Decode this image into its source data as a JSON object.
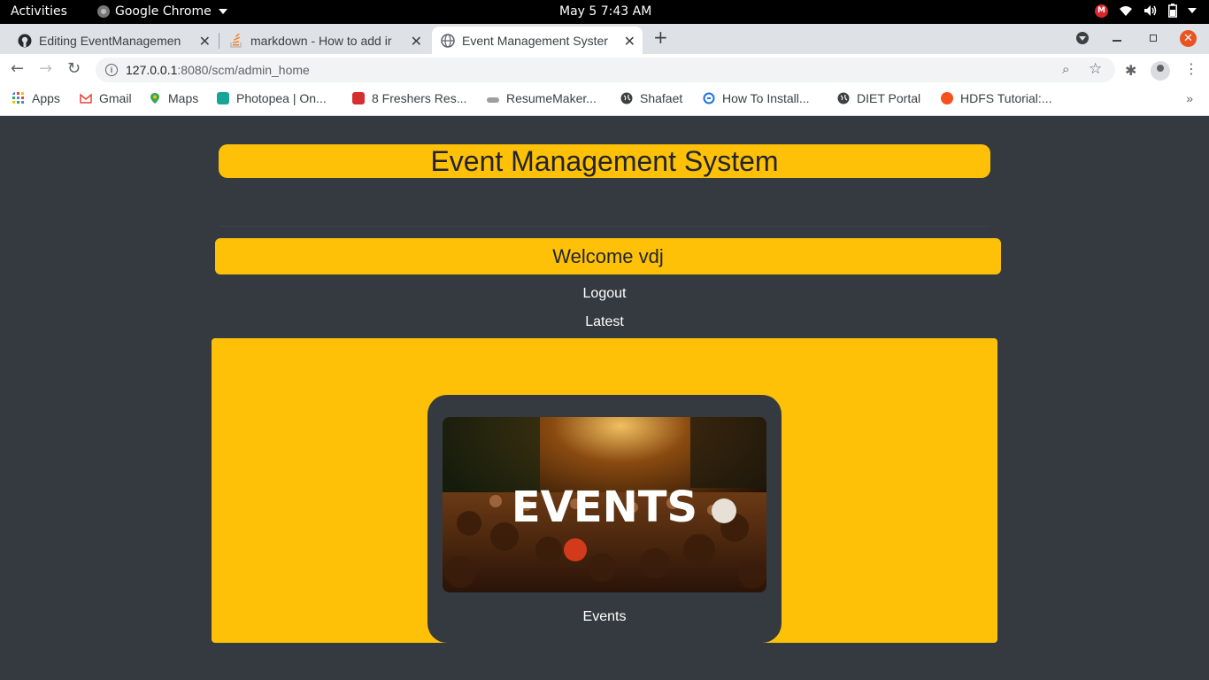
{
  "os": {
    "activities": "Activities",
    "app_name": "Google Chrome",
    "clock": "May 5   7:43 AM"
  },
  "browser": {
    "tabs": [
      {
        "label": "Editing EventManagemen"
      },
      {
        "label": "markdown - How to add ir"
      },
      {
        "label": "Event Management Syster"
      }
    ],
    "url_host": "127.0.0.1",
    "url_rest": ":8080/scm/admin_home",
    "bookmarks": [
      {
        "label": "Apps"
      },
      {
        "label": "Gmail"
      },
      {
        "label": "Maps"
      },
      {
        "label": "Photopea | On..."
      },
      {
        "label": "8 Freshers Res..."
      },
      {
        "label": "ResumeMaker..."
      },
      {
        "label": "Shafaet"
      },
      {
        "label": "How To Install..."
      },
      {
        "label": "DIET Portal"
      },
      {
        "label": "HDFS Tutorial:..."
      }
    ]
  },
  "page": {
    "title": "Event Management System",
    "welcome": "Welcome vdj",
    "logout": "Logout",
    "latest": "Latest",
    "card": {
      "image_text": "EVENTS",
      "caption": "Events"
    }
  },
  "colors": {
    "accent": "#ffc107",
    "background": "#343a40"
  }
}
